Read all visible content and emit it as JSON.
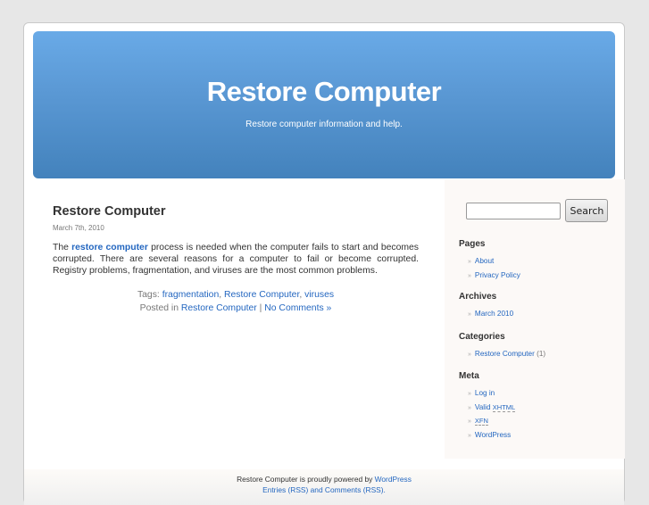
{
  "header": {
    "title": "Restore Computer",
    "description": "Restore computer information and help."
  },
  "post": {
    "title": "Restore Computer",
    "date": "March 7th, 2010",
    "body_prefix": "The ",
    "body_link": "restore computer",
    "body_suffix": " process is needed when the computer fails to start and becomes corrupted.  There are several reasons for a computer to fail or become corrupted.  Registry problems, fragmentation, and viruses are the most common problems.",
    "tags_label": "Tags: ",
    "tags": [
      "fragmentation",
      "Restore Computer",
      "viruses"
    ],
    "posted_in_label": "Posted in ",
    "category": "Restore Computer",
    "separator": " | ",
    "comments": "No Comments »"
  },
  "sidebar": {
    "search": {
      "value": "",
      "button_label": "Search"
    },
    "pages": {
      "title": "Pages",
      "items": [
        "About",
        "Privacy Policy"
      ]
    },
    "archives": {
      "title": "Archives",
      "items": [
        "March 2010"
      ]
    },
    "categories": {
      "title": "Categories",
      "items": [
        {
          "label": "Restore Computer",
          "count": "(1)"
        }
      ]
    },
    "meta": {
      "title": "Meta",
      "login": "Log in",
      "valid_prefix": "Valid ",
      "xhtml": "XHTML",
      "xfn": "XFN",
      "wordpress": "WordPress"
    }
  },
  "footer": {
    "text": "Restore Computer is proudly powered by ",
    "link": "WordPress",
    "line2": "Entries (RSS) and Comments (RSS)."
  }
}
